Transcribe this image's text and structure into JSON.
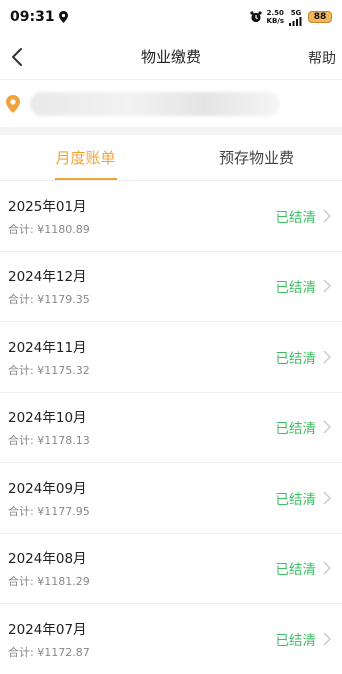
{
  "status_bar": {
    "time": "09:31",
    "net_speed": "2.50",
    "net_unit": "KB/s",
    "network": "5G",
    "battery": "88"
  },
  "nav": {
    "title": "物业缴费",
    "help": "帮助"
  },
  "tabs": [
    {
      "label": "月度账单",
      "active": true
    },
    {
      "label": "预存物业费",
      "active": false
    }
  ],
  "bills": [
    {
      "month": "2025年01月",
      "total": "合计: ¥1180.89",
      "status": "已结清"
    },
    {
      "month": "2024年12月",
      "total": "合计: ¥1179.35",
      "status": "已结清"
    },
    {
      "month": "2024年11月",
      "total": "合计: ¥1175.32",
      "status": "已结清"
    },
    {
      "month": "2024年10月",
      "total": "合计: ¥1178.13",
      "status": "已结清"
    },
    {
      "month": "2024年09月",
      "total": "合计: ¥1177.95",
      "status": "已结清"
    },
    {
      "month": "2024年08月",
      "total": "合计: ¥1181.29",
      "status": "已结清"
    },
    {
      "month": "2024年07月",
      "total": "合计: ¥1172.87",
      "status": "已结清"
    }
  ],
  "colors": {
    "accent": "#f0a33a",
    "settled": "#3cbf63"
  }
}
